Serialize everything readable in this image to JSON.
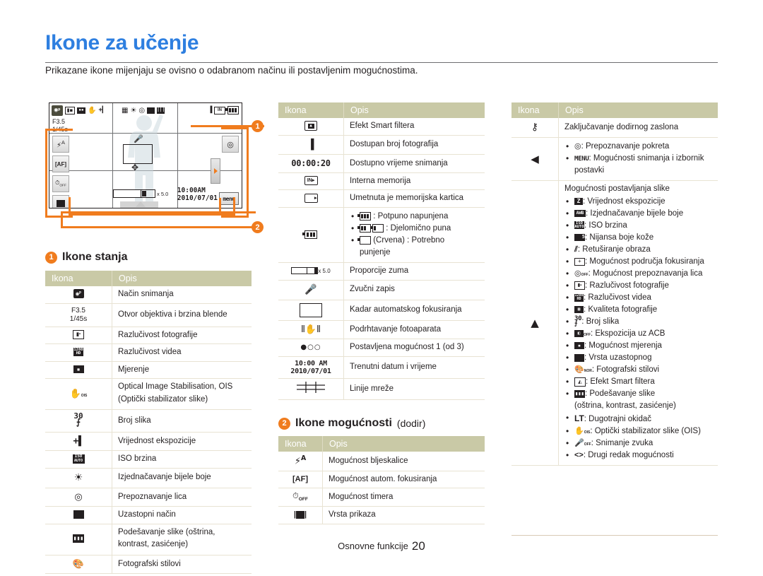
{
  "header": {
    "title": "Ikone za učenje",
    "intro": "Prikazane ikone mijenjaju se ovisno o odabranom načinu ili postavljenim mogućnostima."
  },
  "camera_display": {
    "mode_icon": "camera-program-mode-icon",
    "aperture": "F3.5",
    "shutter": "1/45s",
    "zoom_ratio": "x 5.0",
    "time": "10:00AM",
    "date": "2010/07/01",
    "menu_label": "menu",
    "left_buttons": [
      "flash-auto-icon",
      "af-icon",
      "timer-off-icon",
      "display-type-icon"
    ],
    "right_buttons": [
      "gesture-recognition-icon",
      "menu-button"
    ],
    "callouts": [
      {
        "num": "1",
        "label": "status-icons-callout"
      },
      {
        "num": "2",
        "label": "option-icons-callout"
      }
    ]
  },
  "sections": {
    "status": {
      "num": "1",
      "title": "Ikone stanja",
      "sub": ""
    },
    "options": {
      "num": "2",
      "title": "Ikone mogućnosti",
      "sub": "(dodir)"
    }
  },
  "table_headers": {
    "icon": "Ikona",
    "desc": "Opis"
  },
  "status_table": [
    {
      "icon": "shooting-mode-icon",
      "desc": "Način snimanja"
    },
    {
      "icon": "aperture-shutter-text",
      "icon_text": [
        "F3.5",
        "1/45s"
      ],
      "desc": "Otvor objektiva i brzina blende"
    },
    {
      "icon": "photo-resolution-icon",
      "desc": "Razlučivost fotografije"
    },
    {
      "icon": "video-resolution-icon",
      "desc": "Razlučivost videa"
    },
    {
      "icon": "metering-icon",
      "desc": "Mjerenje"
    },
    {
      "icon": "ois-icon",
      "desc": "Optical Image Stabilisation, OIS",
      "desc2": "(Optički stabilizator slike)"
    },
    {
      "icon": "burst-count-icon",
      "desc": "Broj slika"
    },
    {
      "icon": "exposure-value-icon",
      "desc": "Vrijednost ekspozicije"
    },
    {
      "icon": "iso-icon",
      "desc": "ISO brzina"
    },
    {
      "icon": "white-balance-icon",
      "desc": "Izjednačavanje bijele boje"
    },
    {
      "icon": "face-detection-icon",
      "desc": "Prepoznavanje lica"
    },
    {
      "icon": "burst-mode-icon",
      "desc": "Uzastopni način"
    },
    {
      "icon": "image-adjust-icon",
      "desc": "Podešavanje slike (oštrina,",
      "desc2": "kontrast, zasićenje)"
    },
    {
      "icon": "photo-style-icon",
      "desc": "Fotografski stilovi"
    }
  ],
  "status_table_2": [
    {
      "icon": "smart-filter-icon",
      "desc": "Efekt Smart filtera"
    },
    {
      "icon": "available-shots-icon",
      "desc": "Dostupan broj fotografija"
    },
    {
      "icon": "recording-time-text",
      "icon_text": "00:00:20",
      "desc": "Dostupno vrijeme snimanja"
    },
    {
      "icon": "internal-memory-icon",
      "desc": "Interna memorija"
    },
    {
      "icon": "memory-card-icon",
      "desc": "Umetnuta je memorijska kartica"
    },
    {
      "icon": "battery-icon",
      "desc_bullets": [
        "{battery-full} : Potpuno napunjena",
        "{battery-partial} : Djelomično puna",
        "{battery-empty} (Crvena) : Potrebno",
        "punjenje"
      ]
    },
    {
      "icon": "zoom-ratio-icon",
      "icon_text": "x 5.0",
      "desc": "Proporcije zuma"
    },
    {
      "icon": "voice-memo-icon",
      "desc": "Zvučni zapis"
    },
    {
      "icon": "af-frame-icon",
      "desc": "Kadar automatskog fokusiranja"
    },
    {
      "icon": "camera-shake-icon",
      "desc": "Podrhtavanje fotoaparata"
    },
    {
      "icon": "option-dots-icon",
      "desc": "Postavljena mogućnost 1 (od 3)"
    },
    {
      "icon": "datetime-icon",
      "icon_text": [
        "10:00 AM",
        "2010/07/01"
      ],
      "desc": "Trenutni datum i vrijeme"
    },
    {
      "icon": "grid-lines-icon",
      "desc": "Linije mreže"
    }
  ],
  "options_table": [
    {
      "icon": "flash-option-icon",
      "desc": "Mogućnost bljeskalice"
    },
    {
      "icon": "af-option-icon",
      "desc": "Mogućnost autom. fokusiranja"
    },
    {
      "icon": "timer-option-icon",
      "desc": "Mogućnost timera"
    },
    {
      "icon": "display-type-icon",
      "desc": "Vrsta prikaza"
    }
  ],
  "options_table_right": [
    {
      "icon": "touch-lock-icon",
      "desc": "Zaključavanje dodirnog zaslona"
    },
    {
      "icon": "left-arrow-icon",
      "desc_bullets": [
        "{gesture-icon} : Prepoznavanje pokreta",
        "{MENU} : Mogućnosti snimanja i izbornik",
        "postavki"
      ]
    },
    {
      "icon": "up-arrow-icon",
      "desc_header": "Mogućnosti postavljanja slike",
      "desc_bullets": [
        "{ev} : Vrijednost ekspozicije",
        "{awb} : Izjednačavanje bijele boje",
        "{iso} : ISO brzina",
        "{skin} : Nijansa boje kože",
        "{retouch} : Retuširanje obraza",
        "{focusarea} : Mogućnost područja fokusiranja",
        "{facedetect} : Mogućnost prepoznavanja lica",
        "{photores} : Razlučivost fotografije",
        "{videores} : Razlučivost videa",
        "{quality} : Kvaliteta fotografije",
        "{burst} : Broj slika",
        "{acb} : Ekspozicija uz ACB",
        "{metering} : Mogućnost mjerenja",
        "{bursttype} : Vrsta uzastopnog",
        "{style} : Fotografski stilovi",
        "{smartfilter} : Efekt Smart filtera",
        "{adjust} : Podešavanje slike",
        "(oštrina, kontrast, zasićenje)",
        "{LT} : Dugotrajni okidač",
        "{ois} : Optički stabilizator slike (OIS)",
        "{voiceoff} : Snimanje zvuka",
        "{prevnext} : Drugi redak mogućnosti"
      ]
    }
  ],
  "footer": {
    "label": "Osnovne funkcije",
    "page": "20"
  },
  "colors": {
    "title_blue": "#2e7fe0",
    "accent_orange": "#f07c1e",
    "table_header_bg": "#c9c9a6",
    "row_divider": "#e8e3d3"
  }
}
